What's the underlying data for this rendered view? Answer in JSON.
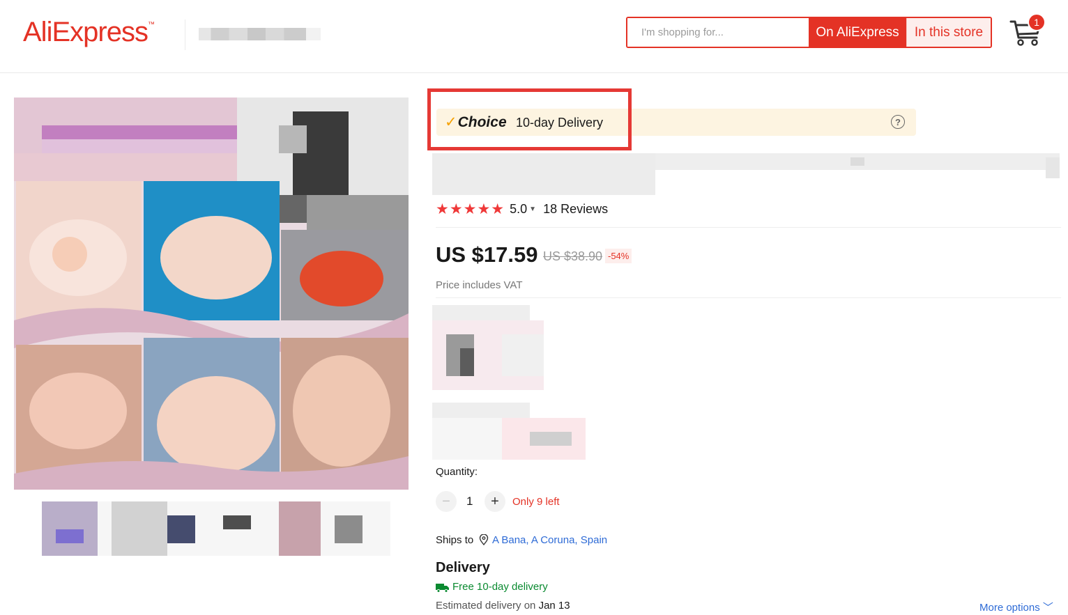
{
  "header": {
    "logo_text": "AliExpress",
    "search_placeholder": "I'm shopping for...",
    "search_on_ali_label": "On AliExpress",
    "search_in_store_label": "In this store",
    "cart_count": "1"
  },
  "choice_banner": {
    "logo_text": "Choice",
    "text": "10-day Delivery",
    "help": "?"
  },
  "rating": {
    "stars": "★★★★★",
    "value": "5.0",
    "reviews": "18 Reviews"
  },
  "price": {
    "current": "US $17.59",
    "original": "US $38.90",
    "discount": "-54%",
    "vat_note": "Price includes VAT"
  },
  "quantity": {
    "label": "Quantity:",
    "minus": "−",
    "value": "1",
    "plus": "+",
    "stock": "Only 9 left"
  },
  "shipping": {
    "label": "Ships to",
    "location": "A Bana, A Coruna, Spain"
  },
  "delivery": {
    "title": "Delivery",
    "free": "Free 10-day delivery",
    "estimate_prefix": "Estimated delivery on ",
    "estimate_date": "Jan 13",
    "more_options": "More options ﹀"
  },
  "colors": {
    "brand": "#e43225",
    "link": "#2e6bd6",
    "success": "#0a8a30",
    "choice_bg": "#fdf4e1",
    "highlight": "#e53935"
  }
}
